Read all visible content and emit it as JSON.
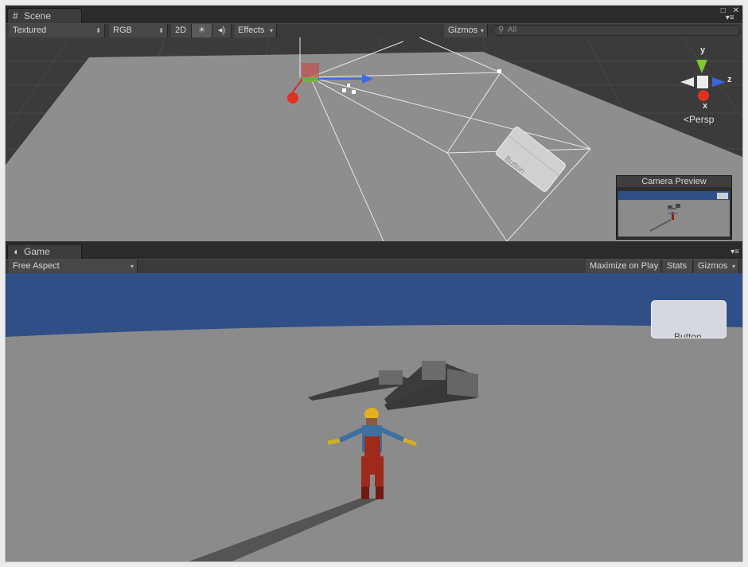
{
  "scene": {
    "tab_label": "Scene",
    "tab_icon": "scene-grid-icon",
    "toolbar": {
      "shading": "Textured",
      "render_mode": "RGB",
      "twod": "2D",
      "lighting_icon": "sun-icon",
      "audio_icon": "speaker-icon",
      "effects": "Effects",
      "gizmos": "Gizmos",
      "search_placeholder": "All"
    },
    "gizmo": {
      "y": "y",
      "x": "x",
      "z": "z",
      "projection": "Persp"
    },
    "world_button_text": "Button",
    "camera_preview": {
      "title": "Camera Preview"
    }
  },
  "game": {
    "tab_label": "Game",
    "tab_icon": "pacman-icon",
    "toolbar": {
      "aspect": "Free Aspect",
      "maximize": "Maximize on Play",
      "stats": "Stats",
      "gizmos": "Gizmos"
    },
    "ui_button_text": "Button"
  },
  "colors": {
    "sky": "#2f4f86",
    "ground": "#8b8b8b",
    "editor_dark": "#3a3a3a"
  }
}
